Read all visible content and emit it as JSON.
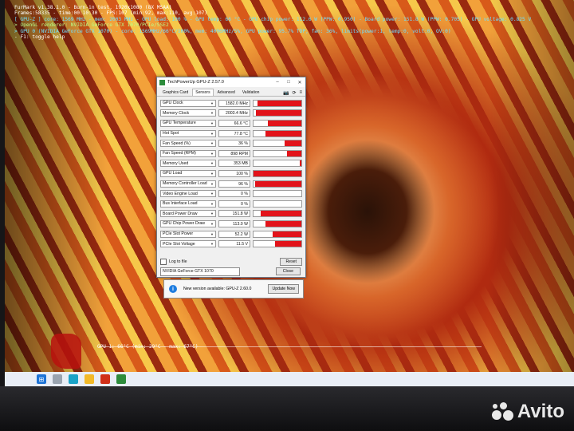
{
  "osd": {
    "line1": "FurMark v1.38.1.0 - Burn-in test, 1920x1080 (8X MSAA)",
    "line2": "Frames:58335 - time:00:10:30 - FPS:107 (min:92, max:110, avg:107)",
    "line3": "[ GPU-Z ] core: 1569 MHz - mem: 2003 MHz - GPU load: 100 % - GPU temp: 66 °C - GPU chip power: 112.6 W (PPW: 0.950) - Board power: 151.8 W (PPW: 0.705) - GPU voltage: 0.825 V",
    "line4": "> OpenGL renderer: NVIDIA GeForce GTX 1070/PCIe/SSE2",
    "line5": "> GPU 0 (NVIDIA GeForce GTX 1070) - core: 1569MHz/66°C/100%, mem: 4006MHz/5%, GPU power: 95.7% TDP, fan: 36%, limits(power:1, temp:0, volt:0, OV:0)",
    "line6": "- F1: toggle help",
    "graph_label": "GPU 1: 66°C (min: 29°C - max: 67°C)"
  },
  "gpuz": {
    "title": "TechPowerUp GPU-Z 2.57.0",
    "tabs": [
      "Graphics Card",
      "Sensors",
      "Advanced",
      "Validation"
    ],
    "active_tab": "Sensors",
    "sensors": [
      {
        "label": "GPU Clock",
        "value": "1582.0 MHz",
        "fill": 0.92
      },
      {
        "label": "Memory Clock",
        "value": "2003.4 MHz",
        "fill": 0.95
      },
      {
        "label": "GPU Temperature",
        "value": "66.6 °C",
        "fill": 0.7
      },
      {
        "label": "Hot Spot",
        "value": "77.8 °C",
        "fill": 0.75
      },
      {
        "label": "Fan Speed (%)",
        "value": "36 %",
        "fill": 0.35
      },
      {
        "label": "Fan Speed (RPM)",
        "value": "898 RPM",
        "fill": 0.3
      },
      {
        "label": "Memory Used",
        "value": "353 MB",
        "fill": 0.04
      },
      {
        "label": "GPU Load",
        "value": "100 %",
        "fill": 1.0
      },
      {
        "label": "Memory Controller Load",
        "value": "96 %",
        "fill": 0.96
      },
      {
        "label": "Video Engine Load",
        "value": "0 %",
        "fill": 0.0
      },
      {
        "label": "Bus Interface Load",
        "value": "0 %",
        "fill": 0.0
      },
      {
        "label": "Board Power Draw",
        "value": "151.8 W",
        "fill": 0.85
      },
      {
        "label": "GPU Chip Power Draw",
        "value": "113.0 W",
        "fill": 0.75
      },
      {
        "label": "PCIe Slot Power",
        "value": "52.2 W",
        "fill": 0.6
      },
      {
        "label": "PCIe Slot Voltage",
        "value": "11.5 V",
        "fill": 0.55
      }
    ],
    "log_label": "Log to file",
    "reset_label": "Reset",
    "gpu_select": "NVIDIA GeForce GTX 1070",
    "close_label": "Close"
  },
  "notification": {
    "text": "New version available: GPU-Z 2.60.0",
    "button": "Update Now"
  },
  "watermark": "Avito",
  "colors": {
    "sensor_bar": "#e2131a",
    "accent": "#1e7de0"
  }
}
